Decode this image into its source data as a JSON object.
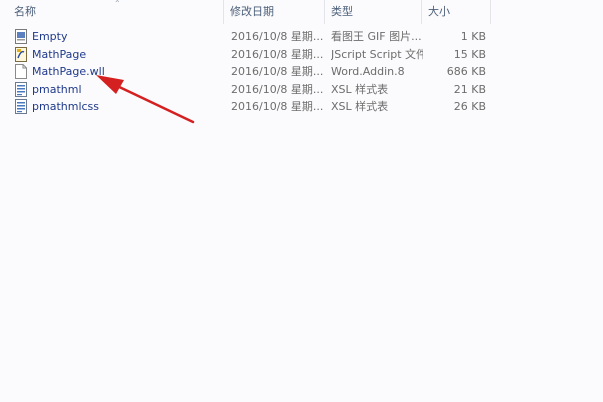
{
  "columns": {
    "name": "名称",
    "date": "修改日期",
    "type": "类型",
    "size": "大小"
  },
  "files": [
    {
      "name": "Empty",
      "date": "2016/10/8 星期...",
      "type": "看图王 GIF 图片...",
      "size": "1 KB",
      "icon": "gif-image-icon"
    },
    {
      "name": "MathPage",
      "date": "2016/10/8 星期...",
      "type": "JScript Script 文件",
      "size": "15 KB",
      "icon": "jscript-file-icon"
    },
    {
      "name": "MathPage.wll",
      "date": "2016/10/8 星期...",
      "type": "Word.Addin.8",
      "size": "686 KB",
      "icon": "blank-file-icon"
    },
    {
      "name": "pmathml",
      "date": "2016/10/8 星期...",
      "type": "XSL 样式表",
      "size": "21 KB",
      "icon": "xsl-file-icon"
    },
    {
      "name": "pmathmlcss",
      "date": "2016/10/8 星期...",
      "type": "XSL 样式表",
      "size": "26 KB",
      "icon": "xsl-file-icon"
    }
  ],
  "colors": {
    "annotation_arrow": "#d42020",
    "file_name": "#1f3a8c",
    "header_text": "#4c607a"
  }
}
